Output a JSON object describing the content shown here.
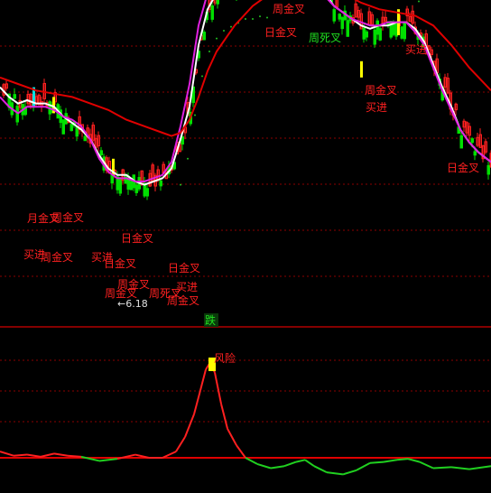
{
  "colors": {
    "background": "#000000",
    "grid": "#8B0000",
    "separator": "#B00000",
    "up": "#FF2020",
    "down": "#00E000",
    "signal_bar": "#FFFF00",
    "doji": "#00E0E0",
    "ma_white": "#FFFFFF",
    "ma_magenta": "#E020E0",
    "ma_red": "#E00000",
    "dots": "#20C020",
    "label_red": "#FF2020",
    "label_green": "#20E020",
    "label_white": "#E0E0E0",
    "oscillator_high": "#FF2020",
    "oscillator_low": "#20D020",
    "baseline": "#E00000",
    "risk_marker": "#FFFF00"
  },
  "chart_data": [
    {
      "type": "candlestick",
      "title": "",
      "ylim": [
        0,
        100
      ],
      "x_count": 180,
      "grid": true,
      "lines": [
        {
          "color_key": "ma_white",
          "values": [
            [
              0,
              69
            ],
            [
              10,
              66
            ],
            [
              20,
              64
            ],
            [
              30,
              65
            ],
            [
              40,
              64
            ],
            [
              50,
              64
            ],
            [
              60,
              63
            ],
            [
              70,
              60
            ],
            [
              80,
              58
            ],
            [
              90,
              56
            ],
            [
              100,
              53
            ],
            [
              110,
              48
            ],
            [
              120,
              44
            ],
            [
              130,
              42
            ],
            [
              140,
              42
            ],
            [
              150,
              40
            ],
            [
              160,
              39
            ],
            [
              170,
              40
            ],
            [
              180,
              41
            ],
            [
              190,
              44
            ],
            [
              200,
              53
            ],
            [
              210,
              63
            ],
            [
              220,
              82
            ],
            [
              230,
              93
            ],
            [
              240,
              98
            ],
            [
              250,
              101
            ],
            [
              260,
              102
            ],
            [
              270,
              104
            ],
            [
              280,
              104
            ],
            [
              290,
              105
            ],
            [
              300,
              104
            ],
            [
              310,
              104
            ],
            [
              320,
              106
            ],
            [
              330,
              108
            ],
            [
              340,
              106
            ],
            [
              350,
              102
            ],
            [
              360,
              98
            ],
            [
              370,
              94
            ],
            [
              380,
              92
            ],
            [
              390,
              90
            ],
            [
              400,
              88
            ],
            [
              410,
              87
            ],
            [
              420,
              88
            ],
            [
              430,
              88
            ],
            [
              440,
              89
            ],
            [
              450,
              89
            ],
            [
              460,
              87
            ],
            [
              470,
              83
            ],
            [
              480,
              76
            ],
            [
              490,
              69
            ],
            [
              500,
              63
            ],
            [
              510,
              56
            ],
            [
              520,
              52
            ],
            [
              530,
              49
            ],
            [
              544,
              46
            ]
          ]
        },
        {
          "color_key": "ma_magenta",
          "values": [
            [
              0,
              66
            ],
            [
              10,
              63
            ],
            [
              20,
              61
            ],
            [
              30,
              63
            ],
            [
              40,
              63
            ],
            [
              50,
              63
            ],
            [
              60,
              62
            ],
            [
              70,
              60
            ],
            [
              80,
              59
            ],
            [
              90,
              57
            ],
            [
              100,
              53
            ],
            [
              110,
              47
            ],
            [
              120,
              43
            ],
            [
              130,
              41
            ],
            [
              140,
              41
            ],
            [
              150,
              40
            ],
            [
              160,
              40
            ],
            [
              170,
              41
            ],
            [
              180,
              42
            ],
            [
              190,
              46
            ],
            [
              200,
              57
            ],
            [
              210,
              70
            ],
            [
              220,
              88
            ],
            [
              230,
              98
            ],
            [
              240,
              104
            ],
            [
              250,
              106
            ],
            [
              260,
              106
            ],
            [
              270,
              106
            ],
            [
              280,
              105
            ],
            [
              290,
              105
            ],
            [
              300,
              105
            ],
            [
              310,
              105
            ],
            [
              320,
              107
            ],
            [
              330,
              109
            ],
            [
              340,
              108
            ],
            [
              350,
              102
            ],
            [
              360,
              97
            ],
            [
              370,
              94
            ],
            [
              380,
              92
            ],
            [
              390,
              90
            ],
            [
              400,
              89
            ],
            [
              410,
              88
            ],
            [
              420,
              88
            ],
            [
              430,
              89
            ],
            [
              440,
              89
            ],
            [
              450,
              89
            ],
            [
              460,
              86
            ],
            [
              470,
              82
            ],
            [
              480,
              75
            ],
            [
              490,
              68
            ],
            [
              500,
              62
            ],
            [
              510,
              56
            ],
            [
              520,
              52
            ],
            [
              530,
              49
            ],
            [
              544,
              46
            ]
          ]
        },
        {
          "color_key": "ma_red",
          "values": [
            [
              0,
              72
            ],
            [
              20,
              70
            ],
            [
              40,
              68
            ],
            [
              60,
              67
            ],
            [
              80,
              66
            ],
            [
              100,
              64
            ],
            [
              120,
              62
            ],
            [
              140,
              59
            ],
            [
              160,
              57
            ],
            [
              180,
              55
            ],
            [
              190,
              54
            ],
            [
              200,
              55
            ],
            [
              210,
              59
            ],
            [
              220,
              66
            ],
            [
              230,
              74
            ],
            [
              240,
              80
            ],
            [
              250,
              84
            ],
            [
              260,
              88
            ],
            [
              270,
              91
            ],
            [
              280,
              94
            ],
            [
              290,
              96
            ],
            [
              300,
              98
            ],
            [
              310,
              99
            ],
            [
              320,
              100
            ],
            [
              340,
              101
            ],
            [
              360,
              100
            ],
            [
              380,
              98
            ],
            [
              400,
              95
            ],
            [
              420,
              93
            ],
            [
              440,
              92
            ],
            [
              460,
              91
            ],
            [
              480,
              88
            ],
            [
              500,
              82
            ],
            [
              520,
              75
            ],
            [
              544,
              68
            ]
          ]
        }
      ],
      "annotations": [
        {
          "text": "月金叉",
          "color_key": "label_red"
        },
        {
          "text": "周金叉",
          "color_key": "label_red"
        },
        {
          "text": "买进",
          "color_key": "label_red"
        },
        {
          "text": "周金叉",
          "color_key": "label_red"
        },
        {
          "text": "日金叉",
          "color_key": "label_red"
        },
        {
          "text": "买进",
          "color_key": "label_red"
        },
        {
          "text": "日金叉",
          "color_key": "label_red"
        },
        {
          "text": "周金叉",
          "color_key": "label_red"
        },
        {
          "text": "周金叉",
          "color_key": "label_red"
        },
        {
          "text": "周死叉",
          "color_key": "label_red"
        },
        {
          "text": "周金叉",
          "color_key": "label_red"
        },
        {
          "text": "日金叉",
          "color_key": "label_red"
        },
        {
          "text": "买进",
          "color_key": "label_red"
        },
        {
          "text": "周金叉",
          "color_key": "label_red"
        },
        {
          "text": "日金叉",
          "color_key": "label_red"
        },
        {
          "text": "周死叉",
          "color_key": "label_green"
        },
        {
          "text": "买进",
          "color_key": "label_red"
        },
        {
          "text": "周金叉",
          "color_key": "label_red"
        },
        {
          "text": "买进",
          "color_key": "label_red"
        },
        {
          "text": "日金叉",
          "color_key": "label_red"
        },
        {
          "text": "←6.18",
          "color_key": "label_white"
        }
      ]
    },
    {
      "type": "line",
      "title": "",
      "badge": "跌",
      "ylim": [
        0,
        100
      ],
      "baseline": 0,
      "values": [
        [
          0,
          6
        ],
        [
          15,
          2
        ],
        [
          30,
          3
        ],
        [
          45,
          1
        ],
        [
          60,
          4
        ],
        [
          75,
          2
        ],
        [
          90,
          1
        ],
        [
          110,
          -3
        ],
        [
          130,
          -1
        ],
        [
          150,
          3
        ],
        [
          165,
          0
        ],
        [
          180,
          0
        ],
        [
          195,
          6
        ],
        [
          205,
          20
        ],
        [
          215,
          42
        ],
        [
          222,
          65
        ],
        [
          228,
          85
        ],
        [
          233,
          92
        ],
        [
          238,
          82
        ],
        [
          245,
          52
        ],
        [
          252,
          28
        ],
        [
          262,
          12
        ],
        [
          272,
          0
        ],
        [
          285,
          -6
        ],
        [
          300,
          -10
        ],
        [
          315,
          -8
        ],
        [
          328,
          -4
        ],
        [
          338,
          -2
        ],
        [
          348,
          -8
        ],
        [
          362,
          -14
        ],
        [
          380,
          -16
        ],
        [
          395,
          -12
        ],
        [
          410,
          -5
        ],
        [
          425,
          -4
        ],
        [
          440,
          -2
        ],
        [
          452,
          -1
        ],
        [
          465,
          -4
        ],
        [
          480,
          -10
        ],
        [
          500,
          -9
        ],
        [
          520,
          -11
        ],
        [
          544,
          -8
        ]
      ],
      "annotations": [
        {
          "text": "风险",
          "color_key": "label_red"
        }
      ]
    }
  ]
}
